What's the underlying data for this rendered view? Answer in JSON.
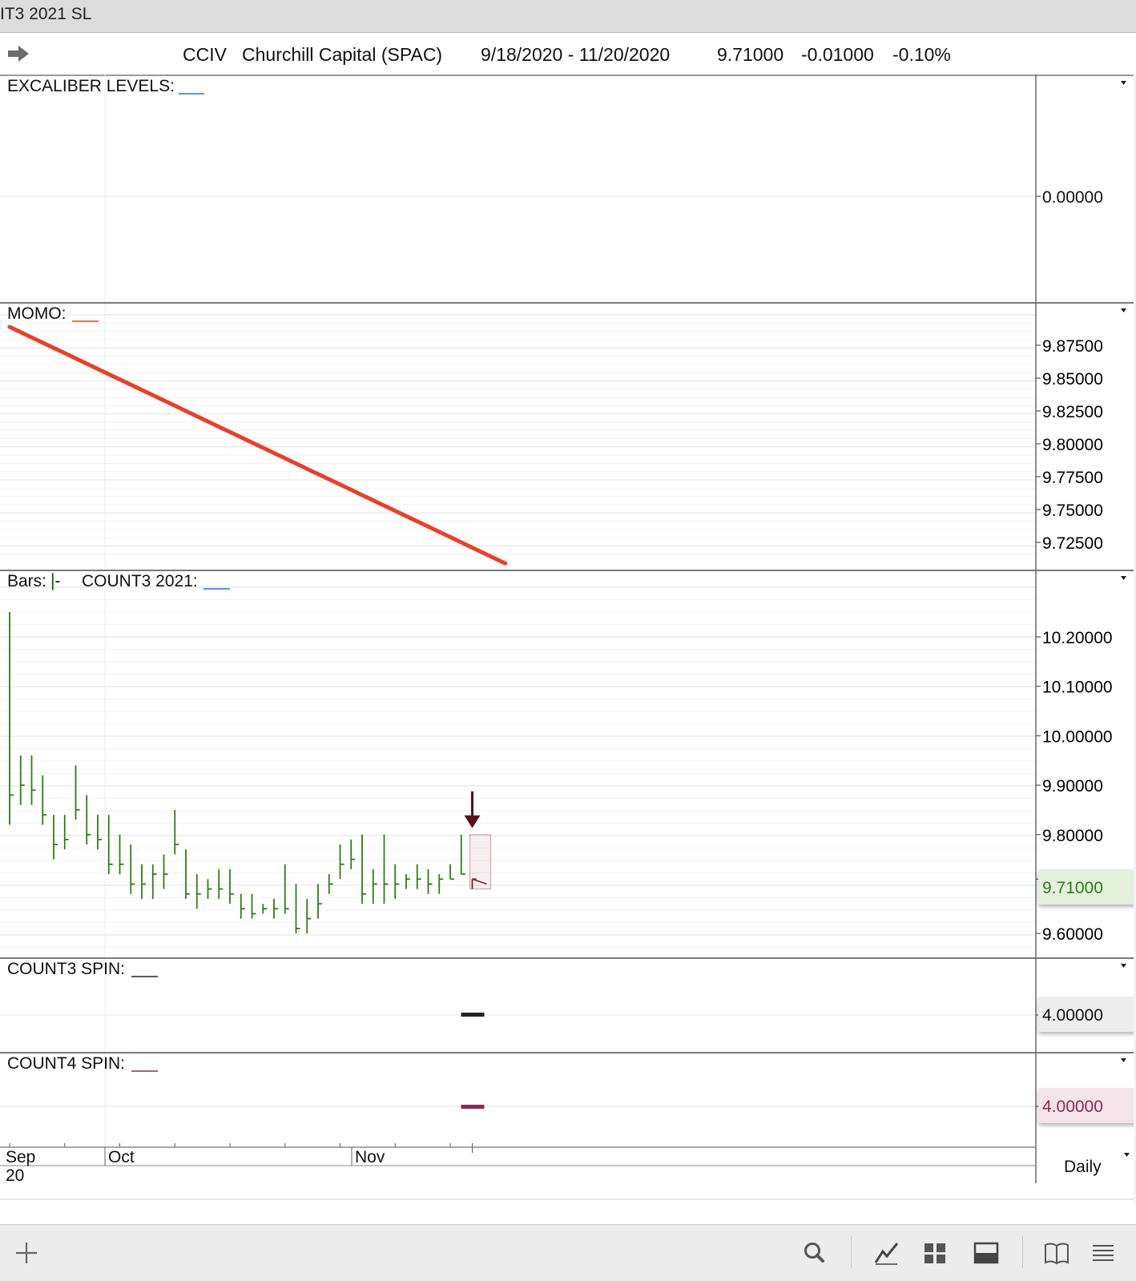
{
  "window": {
    "title": "IT3 2021 SL"
  },
  "header": {
    "symbol": "CCIV",
    "name": "Churchill Capital (SPAC)",
    "date_range": "9/18/2020 - 11/20/2020",
    "last": "9.71000",
    "change": "-0.01000",
    "change_pct": "-0.10%"
  },
  "panels": {
    "excaliber": {
      "label": "EXCALIBER LEVELS:",
      "tick": "0.00000",
      "swatch_color": "#2a6fd6"
    },
    "momo": {
      "label": "MOMO:",
      "ticks": [
        "9.87500",
        "9.85000",
        "9.82500",
        "9.80000",
        "9.77500",
        "9.75000",
        "9.72500"
      ],
      "line_color": "#e8402a"
    },
    "bars": {
      "label": "Bars:",
      "bars_glyph": "|-",
      "study_label": "COUNT3 2021:",
      "ticks": [
        "10.20000",
        "10.10000",
        "10.00000",
        "9.90000",
        "9.80000",
        "9.60000"
      ],
      "last_price_label": "9.71000",
      "bar_color": "#2e7d16",
      "highlight_color": "#7a1f2a"
    },
    "count3": {
      "label": "COUNT3 SPIN:",
      "value_label": "4.00000",
      "bar_color": "#222222"
    },
    "count4": {
      "label": "COUNT4 SPIN:",
      "value_label": "4.00000",
      "bar_color": "#8a2a55"
    }
  },
  "xaxis": {
    "labels": [
      "Sep",
      "Oct",
      "Nov"
    ],
    "sublabel": "20",
    "period": "Daily"
  },
  "toolbar": {
    "icons": [
      "add-icon",
      "search-icon",
      "line-chart-icon",
      "grid-icon",
      "panel-icon",
      "book-icon",
      "menu-icon"
    ]
  },
  "chart_data": [
    {
      "type": "line",
      "title": "MOMO:",
      "ylim": [
        9.71,
        9.895
      ],
      "x": [
        "9/18/2020",
        "9/21/2020",
        "9/22/2020",
        "9/23/2020",
        "9/24/2020",
        "9/25/2020",
        "9/28/2020",
        "9/29/2020",
        "9/30/2020",
        "10/1/2020",
        "10/2/2020",
        "10/5/2020",
        "10/6/2020",
        "10/7/2020",
        "10/8/2020",
        "10/9/2020",
        "10/12/2020",
        "10/13/2020",
        "10/14/2020",
        "10/15/2020",
        "10/16/2020",
        "10/19/2020",
        "10/20/2020",
        "10/21/2020",
        "10/22/2020",
        "10/23/2020",
        "10/26/2020",
        "10/27/2020",
        "10/28/2020",
        "10/29/2020",
        "10/30/2020",
        "11/2/2020",
        "11/3/2020",
        "11/4/2020",
        "11/5/2020",
        "11/6/2020",
        "11/9/2020",
        "11/10/2020",
        "11/11/2020",
        "11/12/2020",
        "11/13/2020",
        "11/16/2020",
        "11/17/2020",
        "11/18/2020",
        "11/19/2020",
        "11/20/2020"
      ],
      "series": [
        {
          "values": [
            9.889,
            9.885,
            9.881,
            9.877,
            9.873,
            9.869,
            9.865,
            9.861,
            9.857,
            9.853,
            9.849,
            9.845,
            9.841,
            9.837,
            9.833,
            9.829,
            9.825,
            9.821,
            9.817,
            9.813,
            9.809,
            9.805,
            9.801,
            9.797,
            9.793,
            9.789,
            9.785,
            9.781,
            9.777,
            9.773,
            9.769,
            9.765,
            9.761,
            9.757,
            9.753,
            9.749,
            9.745,
            9.741,
            9.737,
            9.733,
            9.729,
            9.725,
            9.721,
            9.717,
            9.713,
            9.709
          ]
        }
      ]
    },
    {
      "type": "bar",
      "title": "Bars:",
      "ylim": [
        9.58,
        10.26
      ],
      "x": [
        "9/18/2020",
        "9/21/2020",
        "9/22/2020",
        "9/23/2020",
        "9/24/2020",
        "9/25/2020",
        "9/28/2020",
        "9/29/2020",
        "9/30/2020",
        "10/1/2020",
        "10/2/2020",
        "10/5/2020",
        "10/6/2020",
        "10/7/2020",
        "10/8/2020",
        "10/9/2020",
        "10/12/2020",
        "10/13/2020",
        "10/14/2020",
        "10/15/2020",
        "10/16/2020",
        "10/19/2020",
        "10/20/2020",
        "10/21/2020",
        "10/22/2020",
        "10/23/2020",
        "10/26/2020",
        "10/27/2020",
        "10/28/2020",
        "10/29/2020",
        "10/30/2020",
        "11/2/2020",
        "11/3/2020",
        "11/4/2020",
        "11/5/2020",
        "11/6/2020",
        "11/9/2020",
        "11/10/2020",
        "11/11/2020",
        "11/12/2020",
        "11/13/2020",
        "11/16/2020",
        "11/17/2020",
        "11/18/2020",
        "11/19/2020",
        "11/20/2020"
      ],
      "series": [
        {
          "name": "high",
          "values": [
            10.25,
            9.96,
            9.96,
            9.92,
            9.84,
            9.84,
            9.94,
            9.88,
            9.84,
            9.84,
            9.8,
            9.78,
            9.74,
            9.74,
            9.76,
            9.85,
            9.77,
            9.72,
            9.71,
            9.73,
            9.73,
            9.68,
            9.68,
            9.66,
            9.67,
            9.74,
            9.7,
            9.67,
            9.7,
            9.72,
            9.78,
            9.79,
            9.8,
            9.73,
            9.8,
            9.74,
            9.72,
            9.74,
            9.73,
            9.72,
            9.74,
            9.8,
            9.71
          ]
        },
        {
          "name": "low",
          "values": [
            9.82,
            9.86,
            9.86,
            9.82,
            9.75,
            9.77,
            9.83,
            9.78,
            9.77,
            9.72,
            9.72,
            9.68,
            9.67,
            9.67,
            9.69,
            9.76,
            9.67,
            9.65,
            9.67,
            9.67,
            9.66,
            9.63,
            9.63,
            9.64,
            9.63,
            9.64,
            9.6,
            9.6,
            9.63,
            9.68,
            9.71,
            9.73,
            9.66,
            9.66,
            9.66,
            9.67,
            9.69,
            9.69,
            9.68,
            9.68,
            9.71,
            9.72,
            9.69
          ]
        },
        {
          "name": "close",
          "values": [
            9.88,
            9.9,
            9.89,
            9.84,
            9.78,
            9.79,
            9.85,
            9.8,
            9.79,
            9.74,
            9.74,
            9.7,
            9.7,
            9.72,
            9.72,
            9.78,
            9.68,
            9.68,
            9.69,
            9.69,
            9.68,
            9.65,
            9.64,
            9.65,
            9.65,
            9.65,
            9.61,
            9.63,
            9.66,
            9.7,
            9.74,
            9.75,
            9.68,
            9.7,
            9.7,
            9.7,
            9.71,
            9.71,
            9.7,
            9.71,
            9.71,
            9.72,
            9.71
          ]
        }
      ]
    }
  ]
}
